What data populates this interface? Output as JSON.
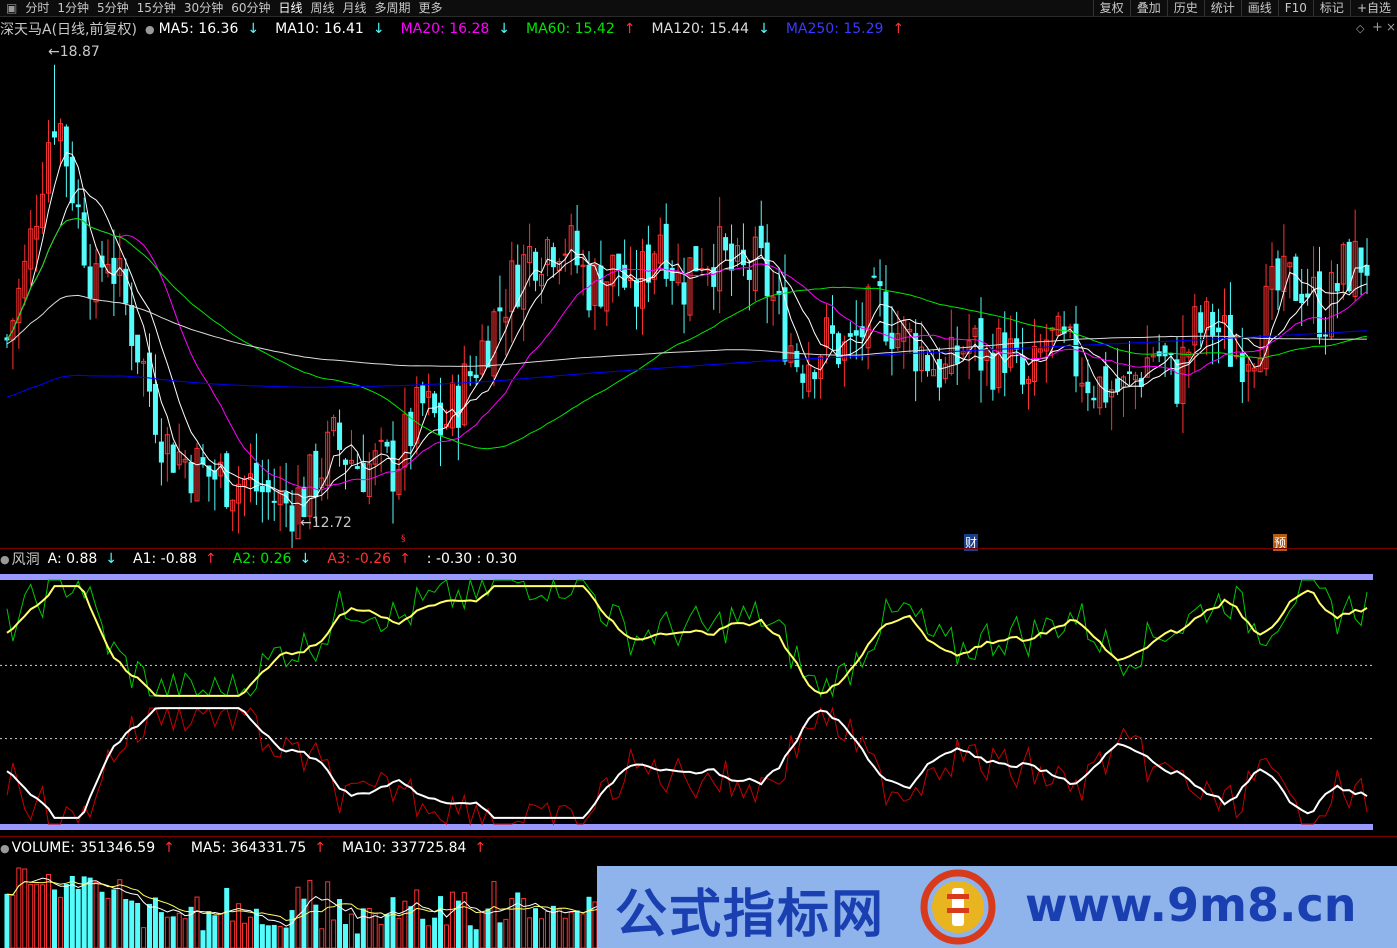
{
  "toolbar": {
    "periods": [
      "分时",
      "1分钟",
      "5分钟",
      "15分钟",
      "30分钟",
      "60分钟",
      "日线",
      "周线",
      "月线",
      "多周期",
      "更多"
    ],
    "active_period": "日线",
    "buttons": [
      "复权",
      "叠加",
      "历史",
      "统计",
      "画线",
      "F10",
      "标记",
      "+自选"
    ]
  },
  "main_legend": {
    "stock": "深天马A(日线,前复权)",
    "ma5": "MA5: 16.36",
    "ma10": "MA10: 16.41",
    "ma20": "MA20: 16.28",
    "ma60": "MA60: 15.42",
    "ma120": "MA120: 15.44",
    "ma250": "MA250: 15.29",
    "arrows": {
      "ma5": "↓",
      "ma10": "↓",
      "ma20": "↓",
      "ma60": "↑",
      "ma120": "↓",
      "ma250": "↑"
    }
  },
  "price_marks": {
    "high": "18.87",
    "low": "12.72"
  },
  "event_marks": [
    "财",
    "预"
  ],
  "indicator_legend": {
    "name": "风洞",
    "a": "A: 0.88",
    "a1": "A1: -0.88",
    "a2": "A2: 0.26",
    "a3": "A3: -0.26",
    "levels": ": -0.30 : 0.30",
    "arrows": {
      "a": "↓",
      "a1": "↑",
      "a2": "↓",
      "a3": "↑"
    }
  },
  "volume_legend": {
    "volume": "VOLUME: 351346.59",
    "ma5": "MA5: 364331.75",
    "ma10": "MA10: 337725.84",
    "arrows": {
      "volume": "↑",
      "ma5": "↑",
      "ma10": "↑"
    }
  },
  "watermark": {
    "left": "公式指标网",
    "right": "www.9m8.cn"
  },
  "colors": {
    "up": "#ff3232",
    "down": "#54fcfc",
    "ma5": "#ffffff",
    "ma10": "#ffffff",
    "ma20": "#ff00ff",
    "ma60": "#00e600",
    "ma120": "#dcdcdc",
    "ma250": "#0000ff",
    "osc_yellow": "#ffff66",
    "osc_green": "#00c800",
    "osc_red": "#c80000",
    "band": "#9898ff"
  },
  "chart_data": {
    "type": "candlestick",
    "price_range": [
      12.72,
      18.87
    ],
    "indicator_range": [
      -1,
      1
    ],
    "osc_levels": [
      -0.3,
      0.3
    ]
  }
}
